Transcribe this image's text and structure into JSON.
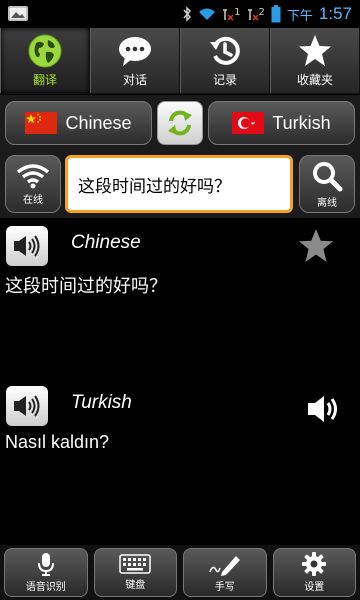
{
  "status_bar": {
    "ampm": "下午",
    "time": "1:57",
    "sim1": "1",
    "sim2": "2"
  },
  "tabs": [
    {
      "label": "翻译",
      "icon": "globe-icon",
      "active": true
    },
    {
      "label": "对话",
      "icon": "chat-bubble-icon",
      "active": false
    },
    {
      "label": "记录",
      "icon": "history-clock-icon",
      "active": false
    },
    {
      "label": "收藏夹",
      "icon": "star-icon",
      "active": false
    }
  ],
  "languages": {
    "source": {
      "name": "Chinese",
      "flag": "china-flag-icon"
    },
    "target": {
      "name": "Turkish",
      "flag": "turkey-flag-icon"
    },
    "swap_icon": "swap-arrows-icon"
  },
  "input": {
    "online_label": "在线",
    "offline_label": "离线",
    "text": "这段时间过的好吗？"
  },
  "results": [
    {
      "language": "Chinese",
      "text": "这段时间过的好吗？",
      "action_icon": "favorite-star-icon"
    },
    {
      "language": "Turkish",
      "text": "Nasıl kaldın?",
      "action_icon": "volume-icon"
    }
  ],
  "bottom_toolbar": [
    {
      "label": "语音识别",
      "icon": "microphone-icon"
    },
    {
      "label": "键盘",
      "icon": "keyboard-icon"
    },
    {
      "label": "手写",
      "icon": "handwriting-pen-icon"
    },
    {
      "label": "设置",
      "icon": "settings-gear-icon"
    }
  ],
  "colors": {
    "active_tab_label": "#a6e52e",
    "input_border": "#f6a02a",
    "clock": "#58b8ff"
  }
}
